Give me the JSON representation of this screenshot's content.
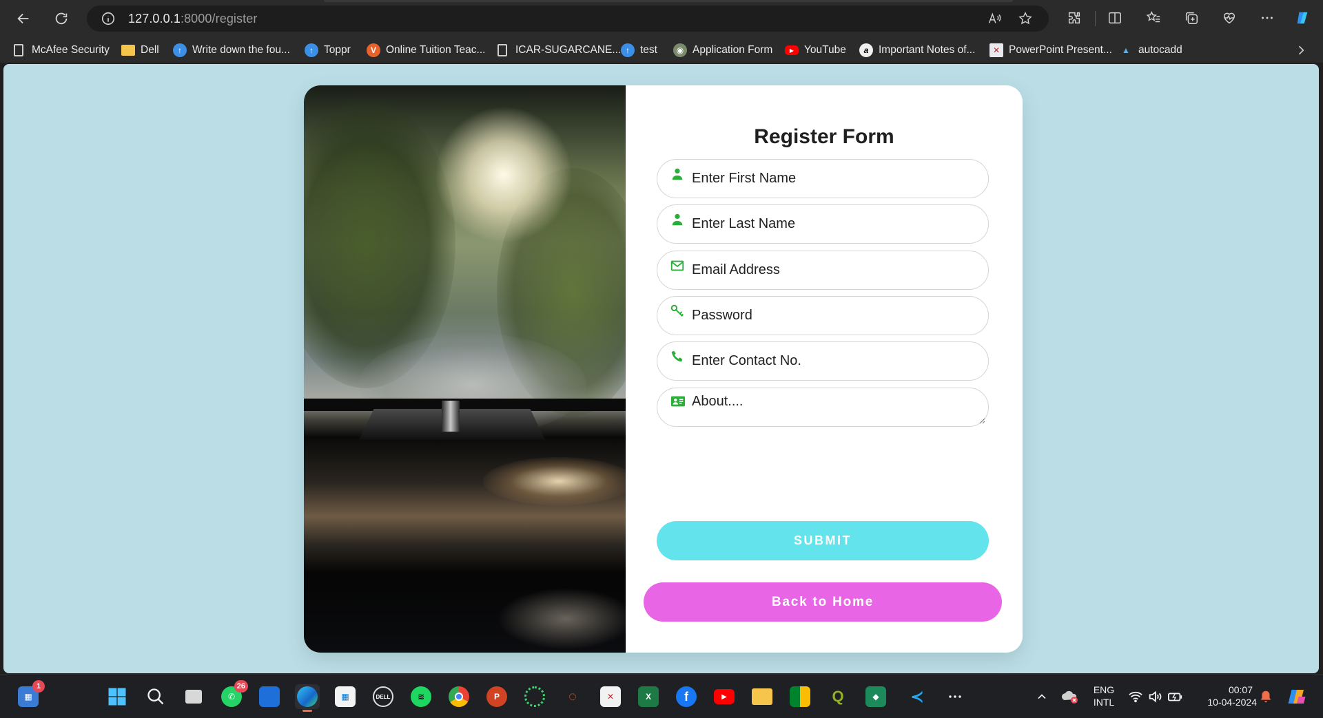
{
  "browser": {
    "url_host": "127.0.0.1",
    "url_path": ":8000/register"
  },
  "bookmarks": [
    {
      "label": "McAfee Security",
      "icon": "page-icon"
    },
    {
      "label": "Dell",
      "icon": "folder-icon"
    },
    {
      "label": "Write down the fou...",
      "icon": "upload-arrow-icon"
    },
    {
      "label": "Toppr",
      "icon": "upload-arrow-icon"
    },
    {
      "label": "Online Tuition Teac...",
      "icon": "v-logo-icon"
    },
    {
      "label": "ICAR-SUGARCANE...",
      "icon": "page-icon"
    },
    {
      "label": "test",
      "icon": "upload-arrow-icon"
    },
    {
      "label": "Application Form",
      "icon": "globe-icon"
    },
    {
      "label": "YouTube",
      "icon": "youtube-icon"
    },
    {
      "label": "Important Notes of...",
      "icon": "a-logo-icon"
    },
    {
      "label": "PowerPoint Present...",
      "icon": "ppt-icon"
    },
    {
      "label": "autocadd",
      "icon": "autocad-icon"
    }
  ],
  "form": {
    "title": "Register Form",
    "first_name_placeholder": "Enter First Name",
    "last_name_placeholder": "Enter Last Name",
    "email_placeholder": "Email Address",
    "password_placeholder": "Password",
    "contact_placeholder": "Enter Contact No.",
    "about_placeholder": "About....",
    "submit_label": "SUBMIT",
    "home_label": "Back to Home"
  },
  "colors": {
    "page_bg": "#bbdee6",
    "icon_green": "#2bae3a",
    "submit_bg": "#63e3ec",
    "home_bg": "#e865e6"
  },
  "taskbar": {
    "widgets_badge": "1",
    "whatsapp_badge": "26",
    "lang_line1": "ENG",
    "lang_line2": "INTL",
    "time": "00:07",
    "date": "10-04-2024"
  }
}
